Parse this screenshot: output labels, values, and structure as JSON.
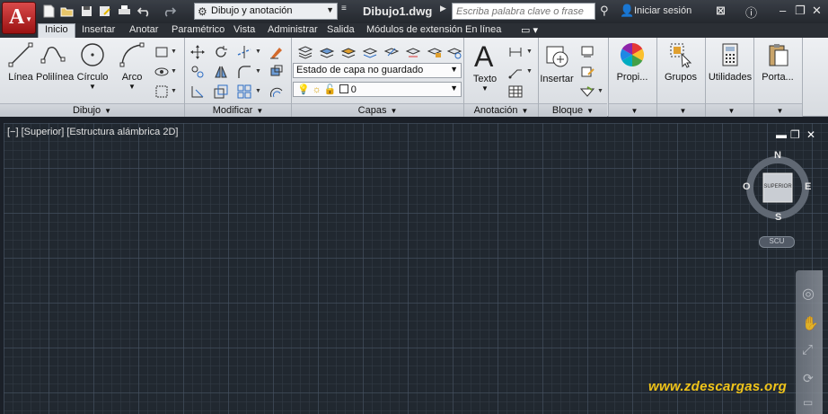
{
  "app": {
    "logo_letter": "A",
    "workspace": "Dibujo y anotación",
    "title": "Dibujo1.dwg",
    "search_placeholder": "Escriba palabra clave o frase",
    "sign_in": "Iniciar sesión"
  },
  "tabs": [
    "Inicio",
    "Insertar",
    "Anotar",
    "Paramétrico",
    "Vista",
    "Administrar",
    "Salida",
    "Módulos de extensión",
    "En línea"
  ],
  "ribbon": {
    "draw": {
      "title": "Dibujo",
      "tools": [
        "Línea",
        "Polilínea",
        "Círculo",
        "Arco"
      ]
    },
    "modify": {
      "title": "Modificar"
    },
    "layers": {
      "title": "Capas",
      "layer_state": "Estado de capa no guardado",
      "current_layer": "0"
    },
    "annotation": {
      "title": "Anotación",
      "text_tool": "Texto"
    },
    "block": {
      "title": "Bloque",
      "insert_tool": "Insertar"
    },
    "properties": {
      "label": "Propi..."
    },
    "groups": {
      "label": "Grupos"
    },
    "utilities": {
      "label": "Utilidades"
    },
    "clipboard": {
      "label": "Porta..."
    }
  },
  "viewport": {
    "label": "[−] [Superior] [Estructura alámbrica 2D]",
    "viewcube": {
      "north": "N",
      "south": "S",
      "east": "E",
      "west": "O",
      "face": "SUPERIOR"
    },
    "wcs": "SCU"
  },
  "watermark": "www.zdescargas.org",
  "colors": {
    "accent_red": "#b31b1b",
    "canvas_bg": "#212830",
    "watermark": "#f0c419"
  }
}
